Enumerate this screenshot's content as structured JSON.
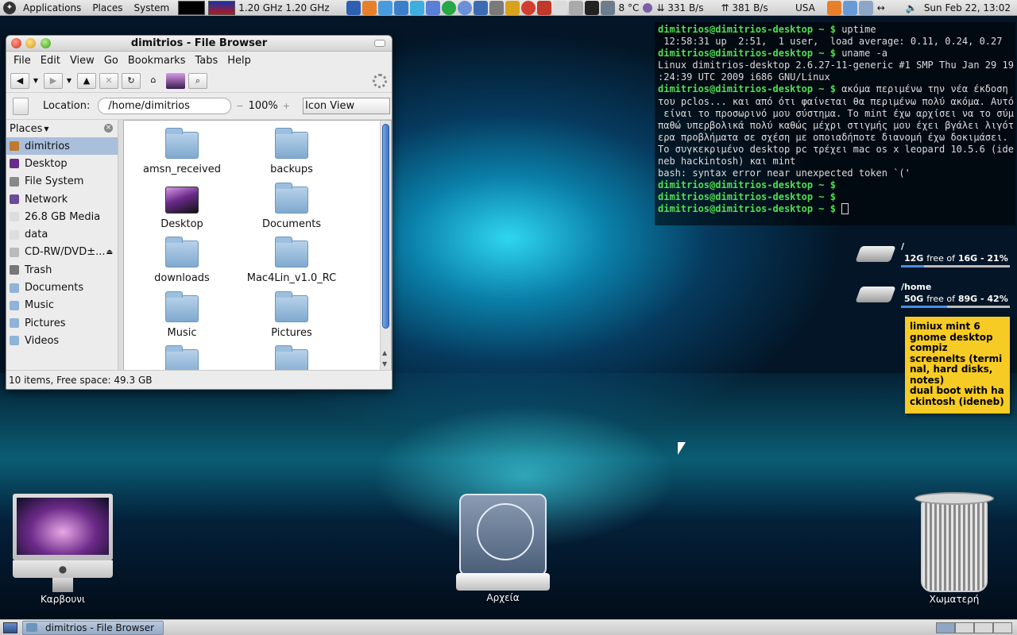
{
  "top_panel": {
    "menus": [
      "Applications",
      "Places",
      "System"
    ],
    "cpu_freq": [
      "1.20 GHz",
      "1.20 GHz"
    ],
    "weather": "8 °C",
    "net_down": "331 B/s",
    "net_up": "381 B/s",
    "keyboard_layout": "USA",
    "clock": "Sun Feb 22, 13:02"
  },
  "file_browser": {
    "title": "dimitrios - File Browser",
    "menu": [
      "File",
      "Edit",
      "View",
      "Go",
      "Bookmarks",
      "Tabs",
      "Help"
    ],
    "location_label": "Location:",
    "location_value": "/home/dimitrios",
    "zoom": "100%",
    "view_mode": "Icon View",
    "places_header": "Places",
    "places": [
      {
        "label": "dimitrios",
        "icon": "home-icon",
        "selected": true
      },
      {
        "label": "Desktop",
        "icon": "desktop-icon"
      },
      {
        "label": "File System",
        "icon": "filesystem-icon"
      },
      {
        "label": "Network",
        "icon": "network-icon"
      },
      {
        "label": "26.8 GB Media",
        "icon": "drive-icon"
      },
      {
        "label": "data",
        "icon": "drive-icon"
      },
      {
        "label": "CD-RW/DVD±...",
        "icon": "optical-drive-icon"
      },
      {
        "label": "Trash",
        "icon": "trash-icon"
      },
      {
        "label": "Documents",
        "icon": "folder-icon"
      },
      {
        "label": "Music",
        "icon": "folder-icon"
      },
      {
        "label": "Pictures",
        "icon": "folder-icon"
      },
      {
        "label": "Videos",
        "icon": "folder-icon"
      }
    ],
    "files": [
      "amsn_received",
      "backups",
      "Desktop",
      "Documents",
      "downloads",
      "Mac4Lin_v1.0_RC",
      "Music",
      "Pictures",
      "",
      ""
    ],
    "status": "10 items, Free space: 49.3 GB"
  },
  "terminal": {
    "prompt": "dimitrios@dimitrios-desktop ~ $",
    "lines": [
      {
        "prompt": true,
        "cmd": " uptime"
      },
      {
        "text": " 12:58:31 up  2:51,  1 user,  load average: 0.11, 0.24, 0.27"
      },
      {
        "prompt": true,
        "cmd": " uname -a"
      },
      {
        "text": "Linux dimitrios-desktop 2.6.27-11-generic #1 SMP Thu Jan 29 19"
      },
      {
        "text": ":24:39 UTC 2009 i686 GNU/Linux"
      },
      {
        "prompt": true,
        "cmd": " ακόμα περιμένω την νέα έκδοση"
      },
      {
        "text": "του pclos... και από ότι φαίνεται θα περιμένω πολύ ακόμα. Αυτό"
      },
      {
        "text": " είναι το προσωρινό μου σύστημα. Το mint έχω αρχίσει να το σύμ"
      },
      {
        "text": "παθώ υπερβολικά πολύ καθώς μέχρι στιγμής μου έχει βγάλει λιγότ"
      },
      {
        "text": "ερα προβλήματα σε σχέση με οποιαδήποτε διανομή έχω δοκιμάσει."
      },
      {
        "text": "Το συγκεκριμένο desktop pc τρέχει mac os x leopard 10.5.6 (ide"
      },
      {
        "text": "neb hackintosh) και mint"
      },
      {
        "text": "bash: syntax error near unexpected token `('"
      },
      {
        "prompt": true,
        "cmd": ""
      },
      {
        "prompt": true,
        "cmd": ""
      },
      {
        "prompt": true,
        "cmd": " ",
        "cursor": true
      }
    ]
  },
  "disks": [
    {
      "mount": "/",
      "free": "12G",
      "free_word": "free of",
      "total": "16G",
      "used_pct": "21%",
      "used": 0.21
    },
    {
      "mount": "/home",
      "free": "50G",
      "free_word": "free of",
      "total": "89G",
      "used_pct": "42%",
      "used": 0.42
    }
  ],
  "note": {
    "lines": [
      "limiux mint 6",
      "gnome desktop",
      "compiz",
      "screenelts (termi",
      "nal, hard disks,",
      "notes)",
      "dual boot with ha",
      "ckintosh (ideneb)"
    ]
  },
  "desktop_icons": [
    {
      "label": "Καρβουνι"
    },
    {
      "label": "Αρχεία"
    },
    {
      "label": "Χωματερή"
    }
  ],
  "taskbar": {
    "window_button": "dimitrios - File Browser"
  }
}
